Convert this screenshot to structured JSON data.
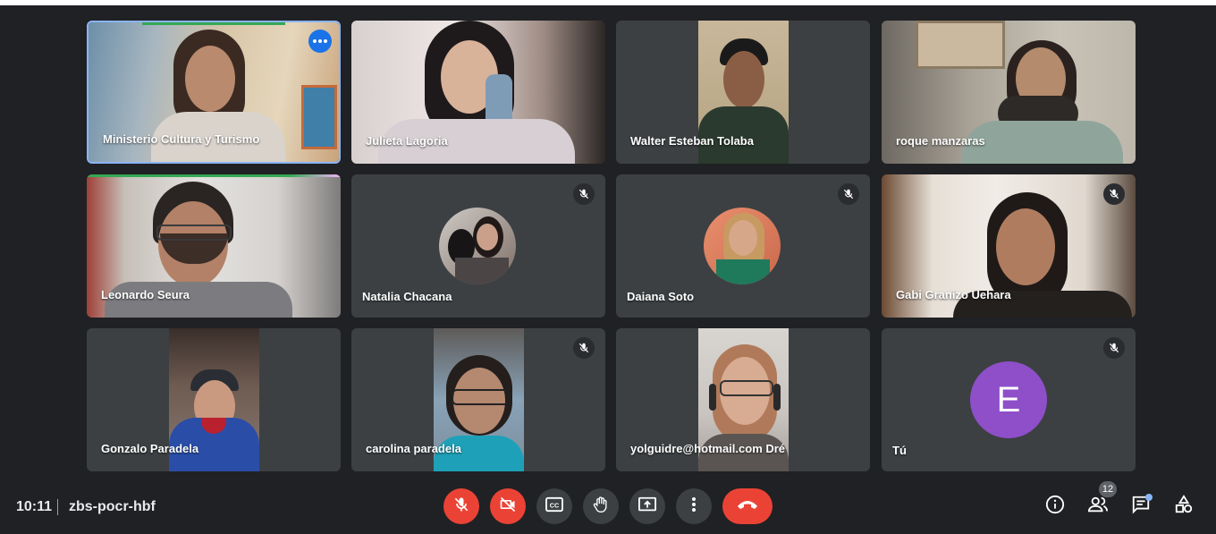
{
  "participants": [
    {
      "name": "Ministerio Cultura y Turismo"
    },
    {
      "name": "Julieta Lagoria"
    },
    {
      "name": "Walter Esteban Tolaba"
    },
    {
      "name": "roque manzaras"
    },
    {
      "name": "Leonardo Seura"
    },
    {
      "name": "Natalia Chacana"
    },
    {
      "name": "Daiana Soto"
    },
    {
      "name": "Gabi Granizo Uehara"
    },
    {
      "name": "Gonzalo Paradela"
    },
    {
      "name": "carolina paradela"
    },
    {
      "name": "yolguidre@hotmail.com Dré"
    },
    {
      "name": "Tú",
      "avatar_letter": "E"
    }
  ],
  "meeting": {
    "time": "10:11",
    "code": "zbs-pocr-hbf",
    "participant_count": "12"
  },
  "icons": [
    "mic-off-icon",
    "camera-off-icon",
    "captions-icon",
    "raise-hand-icon",
    "present-screen-icon",
    "more-options-icon",
    "end-call-icon",
    "info-icon",
    "people-icon",
    "chat-icon",
    "activities-icon"
  ],
  "colors": {
    "accent": "#1a73e8",
    "danger": "#ea4335",
    "tile": "#3c4043",
    "background": "#202124",
    "avatar": "#8e4fc8"
  }
}
